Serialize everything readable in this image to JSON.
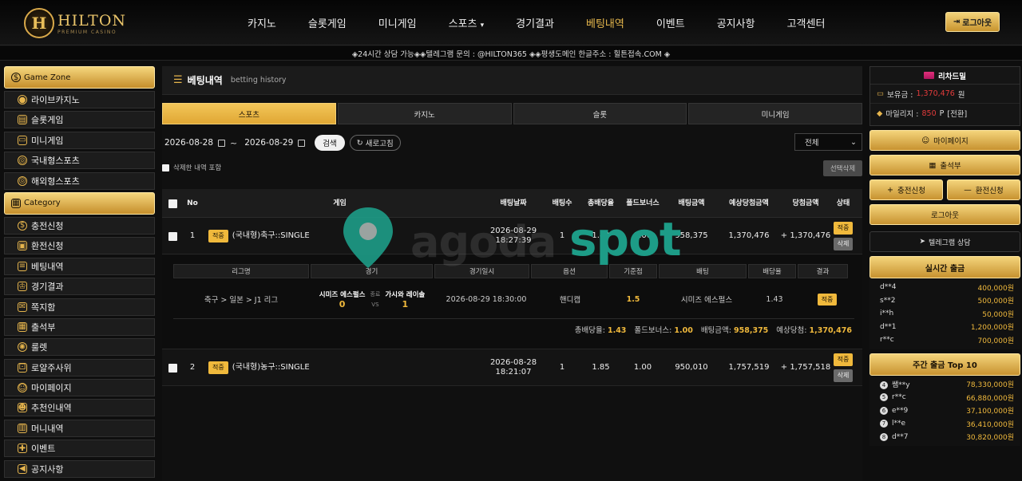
{
  "brand": {
    "badge": "H",
    "name": "HILTON",
    "sub": "PREMIUM CASINO"
  },
  "nav": [
    {
      "label": "카지노",
      "active": false
    },
    {
      "label": "슬롯게임",
      "active": false
    },
    {
      "label": "미니게임",
      "active": false
    },
    {
      "label": "스포츠",
      "active": false,
      "caret": "▾"
    },
    {
      "label": "경기결과",
      "active": false
    },
    {
      "label": "베팅내역",
      "active": true
    },
    {
      "label": "이벤트",
      "active": false
    },
    {
      "label": "공지사항",
      "active": false
    },
    {
      "label": "고객센터",
      "active": false
    }
  ],
  "logout_top": "로그아웃",
  "ticker": "◈24시간 상담 가능◈◈텔레그램 문의 : @HILTON365 ◈◈평생도메인 한글주소 : 힐튼접속.COM ◈",
  "left_sidebar": {
    "game_zone": "Game Zone",
    "game_items": [
      "라이브카지노",
      "슬롯게임",
      "미니게임",
      "국내형스포츠",
      "해외형스포츠"
    ],
    "category": "Category",
    "category_items": [
      "충전신청",
      "환전신청",
      "베팅내역",
      "경기결과",
      "쪽지함",
      "출석부",
      "룰렛",
      "로얄주사위",
      "마이페이지",
      "추천인내역",
      "머니내역",
      "이벤트",
      "공지사항"
    ]
  },
  "main": {
    "title": "베팅내역",
    "subtitle": "betting history",
    "tabs": [
      "스포츠",
      "카지노",
      "슬롯",
      "미니게임"
    ],
    "date_from": "2026-08-28",
    "date_sep": "~",
    "date_to": "2026-08-29",
    "search_btn": "검색",
    "refresh_btn": "새로고침",
    "refresh_icon": "↻",
    "select_value": "전체",
    "include_deleted": "삭제한 내역 포함",
    "delete_selected": "선택삭제",
    "columns": [
      "No",
      "게임",
      "배팅날짜",
      "배팅수",
      "총배당율",
      "폴드보너스",
      "배팅금액",
      "예상당첨금액",
      "당첨금액",
      "상태"
    ],
    "rows": [
      {
        "no": "1",
        "tag": "적중",
        "game": "(국내형)축구::SINGLE",
        "date": "2026-08-29",
        "time": "18:27:39",
        "count": "1",
        "odds": "1.43",
        "bonus": "1.00",
        "amount": "958,375",
        "expected": "1,370,476",
        "won": "+ 1,370,476",
        "status": "적중",
        "action": "삭제"
      },
      {
        "no": "2",
        "tag": "적중",
        "game": "(국내형)농구::SINGLE",
        "date": "2026-08-28",
        "time": "18:21:07",
        "count": "1",
        "odds": "1.85",
        "bonus": "1.00",
        "amount": "950,010",
        "expected": "1,757,519",
        "won": "+ 1,757,518",
        "status": "적중",
        "action": "삭제"
      }
    ],
    "detail": {
      "columns": [
        "리그명",
        "경기",
        "경기일시",
        "옵션",
        "기준점",
        "배팅",
        "배당율",
        "결과"
      ],
      "league": "축구 > 일본 > J1 리그",
      "home": "시미즈 에스펄스",
      "home_score": "0",
      "status": "종료",
      "vs": "VS",
      "away": "가시와 레이솔",
      "away_score": "1",
      "datetime": "2026-08-29 18:30:00",
      "option": "핸디캡",
      "baseline": "1.5",
      "pick": "시미즈 에스펄스",
      "pick_odds": "1.43",
      "result": "적중",
      "sum_odds_label": "총배당율:",
      "sum_odds": "1.43",
      "sum_bonus_label": "폴드보너스:",
      "sum_bonus": "1.00",
      "sum_amount_label": "배팅금액:",
      "sum_amount": "958,375",
      "sum_expected_label": "예상당첨:",
      "sum_expected": "1,370,476"
    }
  },
  "right_sidebar": {
    "user": "리차드밀",
    "balance_label": "보유금 :",
    "balance": "1,370,476",
    "balance_unit": "원",
    "mileage_label": "마일리지 :",
    "mileage": "850",
    "mileage_unit": "P",
    "convert": "[전환]",
    "mypage": "마이페이지",
    "attendance": "출석부",
    "deposit": "충전신청",
    "withdraw": "환전신청",
    "logout": "로그아웃",
    "telegram": "텔레그램 상담",
    "live_title": "실시간 출금",
    "live_list": [
      {
        "user": "d**4",
        "amount": "400,000원"
      },
      {
        "user": "s**2",
        "amount": "500,000원"
      },
      {
        "user": "i**h",
        "amount": "50,000원"
      },
      {
        "user": "d**1",
        "amount": "1,200,000원"
      },
      {
        "user": "r**c",
        "amount": "700,000원"
      }
    ],
    "weekly_title": "주간 출금 Top 10",
    "weekly_list": [
      {
        "rank": "4",
        "user": "쌤**y",
        "amount": "78,330,000원"
      },
      {
        "rank": "5",
        "user": "r**c",
        "amount": "66,880,000원"
      },
      {
        "rank": "6",
        "user": "e**9",
        "amount": "37,100,000원"
      },
      {
        "rank": "7",
        "user": "l**e",
        "amount": "36,410,000원"
      },
      {
        "rank": "8",
        "user": "d**7",
        "amount": "30,820,000원"
      }
    ]
  },
  "watermark": {
    "part1": "agoda",
    "part2": "spot"
  },
  "colors": {
    "gold": "#f0b93c",
    "accent_red": "#e23b3b",
    "watermark_green": "#1d9c87"
  }
}
